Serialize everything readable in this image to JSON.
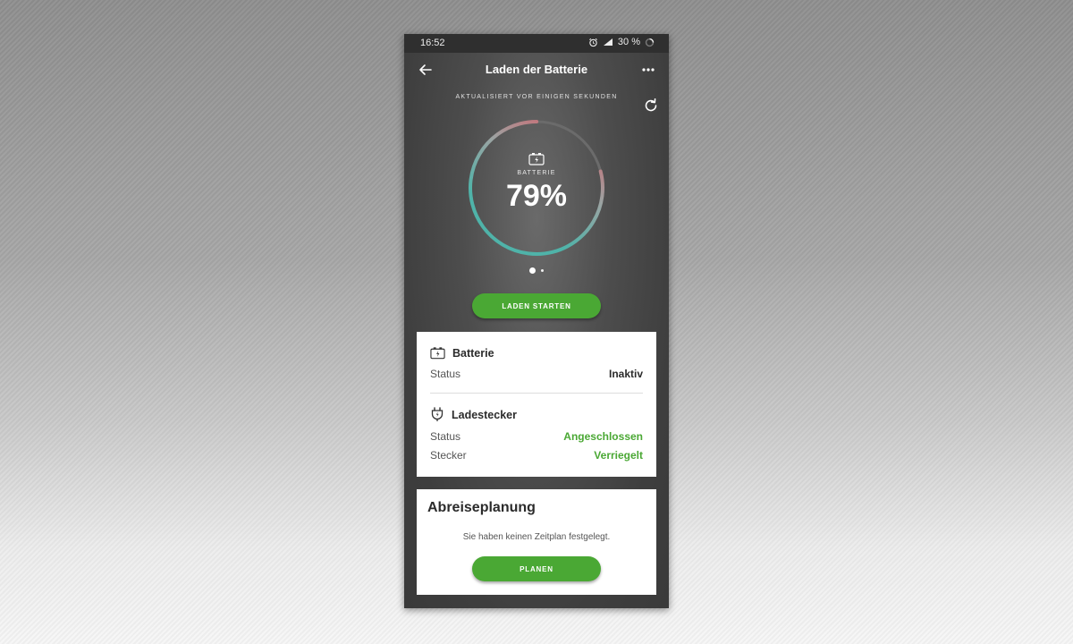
{
  "status_bar": {
    "time": "16:52",
    "battery": "30 %"
  },
  "header": {
    "title": "Laden der Batterie"
  },
  "update": {
    "text": "AKTUALISIERT VOR EINIGEN SEKUNDEN"
  },
  "gauge": {
    "label": "BATTERIE",
    "value": "79%",
    "level": 0.79
  },
  "carousel": {
    "pages": 2,
    "active": 0
  },
  "actions": {
    "start_label": "LADEN STARTEN"
  },
  "battery_section": {
    "title": "Batterie",
    "rows": [
      {
        "key": "Status",
        "value": "Inaktiv"
      }
    ]
  },
  "plug_section": {
    "title": "Ladestecker",
    "rows": [
      {
        "key": "Status",
        "value": "Angeschlossen"
      },
      {
        "key": "Stecker",
        "value": "Verriegelt"
      }
    ]
  },
  "planning": {
    "title": "Abreiseplanung",
    "text": "Sie haben keinen Zeitplan festgelegt.",
    "button_label": "PLANEN"
  },
  "colors": {
    "accent_green": "#4aa834",
    "gauge_teal": "#4fb3a9",
    "gauge_red": "#e4525e",
    "gauge_track": "#6b6b6b"
  },
  "icons": {
    "status_alarm": "alarm-icon",
    "status_signal": "signal-icon",
    "back": "arrow-left-icon",
    "more": "more-dots-icon",
    "refresh": "refresh-icon",
    "battery": "battery-icon",
    "plug": "plug-icon"
  }
}
